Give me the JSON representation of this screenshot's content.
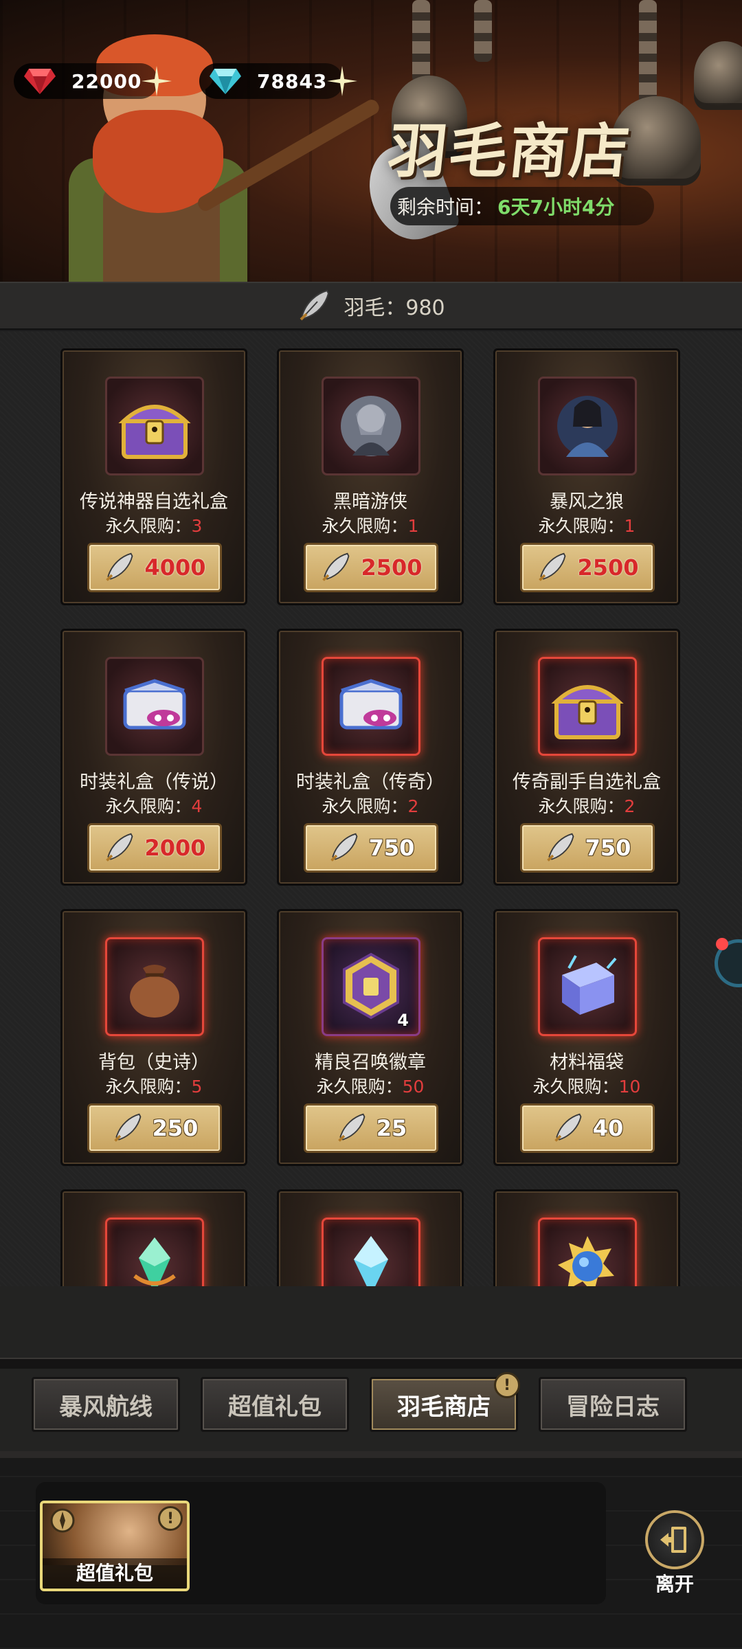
{
  "currencies": [
    {
      "name": "ruby",
      "value": "22000",
      "color": "#e0303a"
    },
    {
      "name": "diamond",
      "value": "78843",
      "color": "#3ec5d6"
    }
  ],
  "shop": {
    "title": "羽毛商店",
    "timer_label": "剩余时间：",
    "timer_value": "6天7小时4分",
    "feather_balance": "羽毛：980"
  },
  "items": [
    {
      "name": "传说神器自选礼盒",
      "limit_label": "永久限购：",
      "limit": "3",
      "price": "4000",
      "price_color": "red",
      "icon": "treasure-chest-icon"
    },
    {
      "name": "黑暗游侠",
      "limit_label": "永久限购：",
      "limit": "1",
      "price": "2500",
      "price_color": "red",
      "icon": "dark-ranger-portrait-icon"
    },
    {
      "name": "暴风之狼",
      "limit_label": "永久限购：",
      "limit": "1",
      "price": "2500",
      "price_color": "red",
      "icon": "storm-wolf-portrait-icon"
    },
    {
      "name": "时装礼盒（传说）",
      "limit_label": "永久限购：",
      "limit": "4",
      "price": "2000",
      "price_color": "red",
      "icon": "costume-box-icon"
    },
    {
      "name": "时装礼盒（传奇）",
      "limit_label": "永久限购：",
      "limit": "2",
      "price": "750",
      "price_color": "white",
      "icon": "costume-box-icon"
    },
    {
      "name": "传奇副手自选礼盒",
      "limit_label": "永久限购：",
      "limit": "2",
      "price": "750",
      "price_color": "white",
      "icon": "treasure-chest-icon"
    },
    {
      "name": "背包（史诗）",
      "limit_label": "永久限购：",
      "limit": "5",
      "price": "250",
      "price_color": "white",
      "icon": "backpack-bag-icon"
    },
    {
      "name": "精良召唤徽章",
      "limit_label": "永久限购：",
      "limit": "50",
      "price": "25",
      "price_color": "white",
      "icon": "summon-badge-icon",
      "quantity": "4"
    },
    {
      "name": "材料福袋",
      "limit_label": "永久限购：",
      "limit": "10",
      "price": "40",
      "price_color": "white",
      "icon": "material-crystal-box-icon"
    }
  ],
  "partial_items": [
    {
      "icon": "green-crystal-icon"
    },
    {
      "icon": "blue-crystal-icon"
    },
    {
      "icon": "blue-gem-gear-icon"
    }
  ],
  "tabs": [
    {
      "label": "暴风航线",
      "active": false
    },
    {
      "label": "超值礼包",
      "active": false
    },
    {
      "label": "羽毛商店",
      "active": true,
      "badge": "!"
    },
    {
      "label": "冒险日志",
      "active": false
    }
  ],
  "bottom": {
    "gift_label": "超值礼包",
    "gift_badge": "!",
    "leave_label": "离开"
  }
}
